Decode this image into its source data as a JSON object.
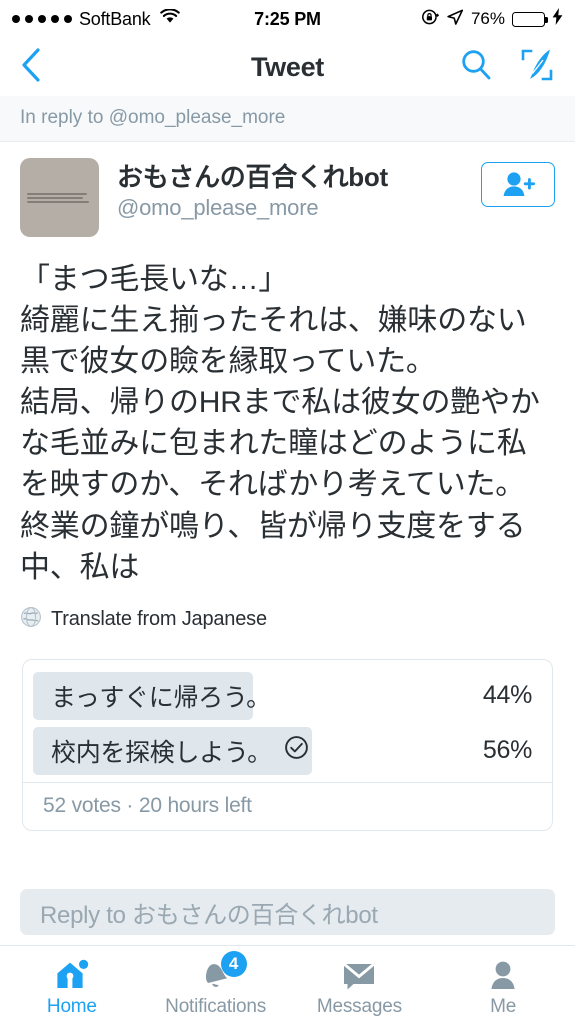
{
  "status_bar": {
    "signal_dots": 5,
    "carrier": "SoftBank",
    "wifi_icon": "wifi-icon",
    "time": "7:25 PM",
    "rotation_lock_icon": "rotation-lock-icon",
    "location_icon": "location-arrow-icon",
    "battery_percent": "76%",
    "battery_level": 76,
    "charging_icon": "lightning-bolt-icon"
  },
  "nav": {
    "back_icon": "chevron-left-icon",
    "title": "Tweet",
    "search_icon": "search-icon",
    "compose_icon": "compose-tweet-icon",
    "accent_color": "#1da1f2",
    "title_color": "#292f33"
  },
  "in_reply_to": {
    "text": "In reply to @omo_please_more"
  },
  "tweet": {
    "author_name": "おもさんの百合くれbot",
    "author_handle": "@omo_please_more",
    "avatar_icon": "user-avatar",
    "follow_icon": "add-person-icon",
    "body": "「まつ毛長いな…」\n綺麗に生え揃ったそれは、嫌味のない黒で彼女の瞼を縁取っていた。\n結局、帰りのHRまで私は彼女の艶やかな毛並みに包まれた瞳はどのように私を映すのか、そればかり考えていた。\n終業の鐘が鳴り、皆が帰り支度をする中、私は",
    "translate_icon": "globe-icon",
    "translate_label": "Translate from Japanese"
  },
  "poll": {
    "options": [
      {
        "label": "まっすぐに帰ろう。",
        "percent": "44%",
        "value": 44,
        "voted": false
      },
      {
        "label": "校内を探検しよう。",
        "percent": "56%",
        "value": 56,
        "voted": true
      }
    ],
    "voted_icon": "check-circle-icon",
    "footer": "52 votes · 20 hours left",
    "bar_color": "#dfe6ec"
  },
  "reply_box": {
    "placeholder": "Reply to おもさんの百合くれbot"
  },
  "tabs": [
    {
      "label": "Home",
      "icon": "home-icon",
      "active": true,
      "badge": "",
      "dot": true
    },
    {
      "label": "Notifications",
      "icon": "bell-icon",
      "active": false,
      "badge": "4",
      "dot": false
    },
    {
      "label": "Messages",
      "icon": "envelope-icon",
      "active": false,
      "badge": "",
      "dot": false
    },
    {
      "label": "Me",
      "icon": "person-icon",
      "active": false,
      "badge": "",
      "dot": false
    }
  ]
}
